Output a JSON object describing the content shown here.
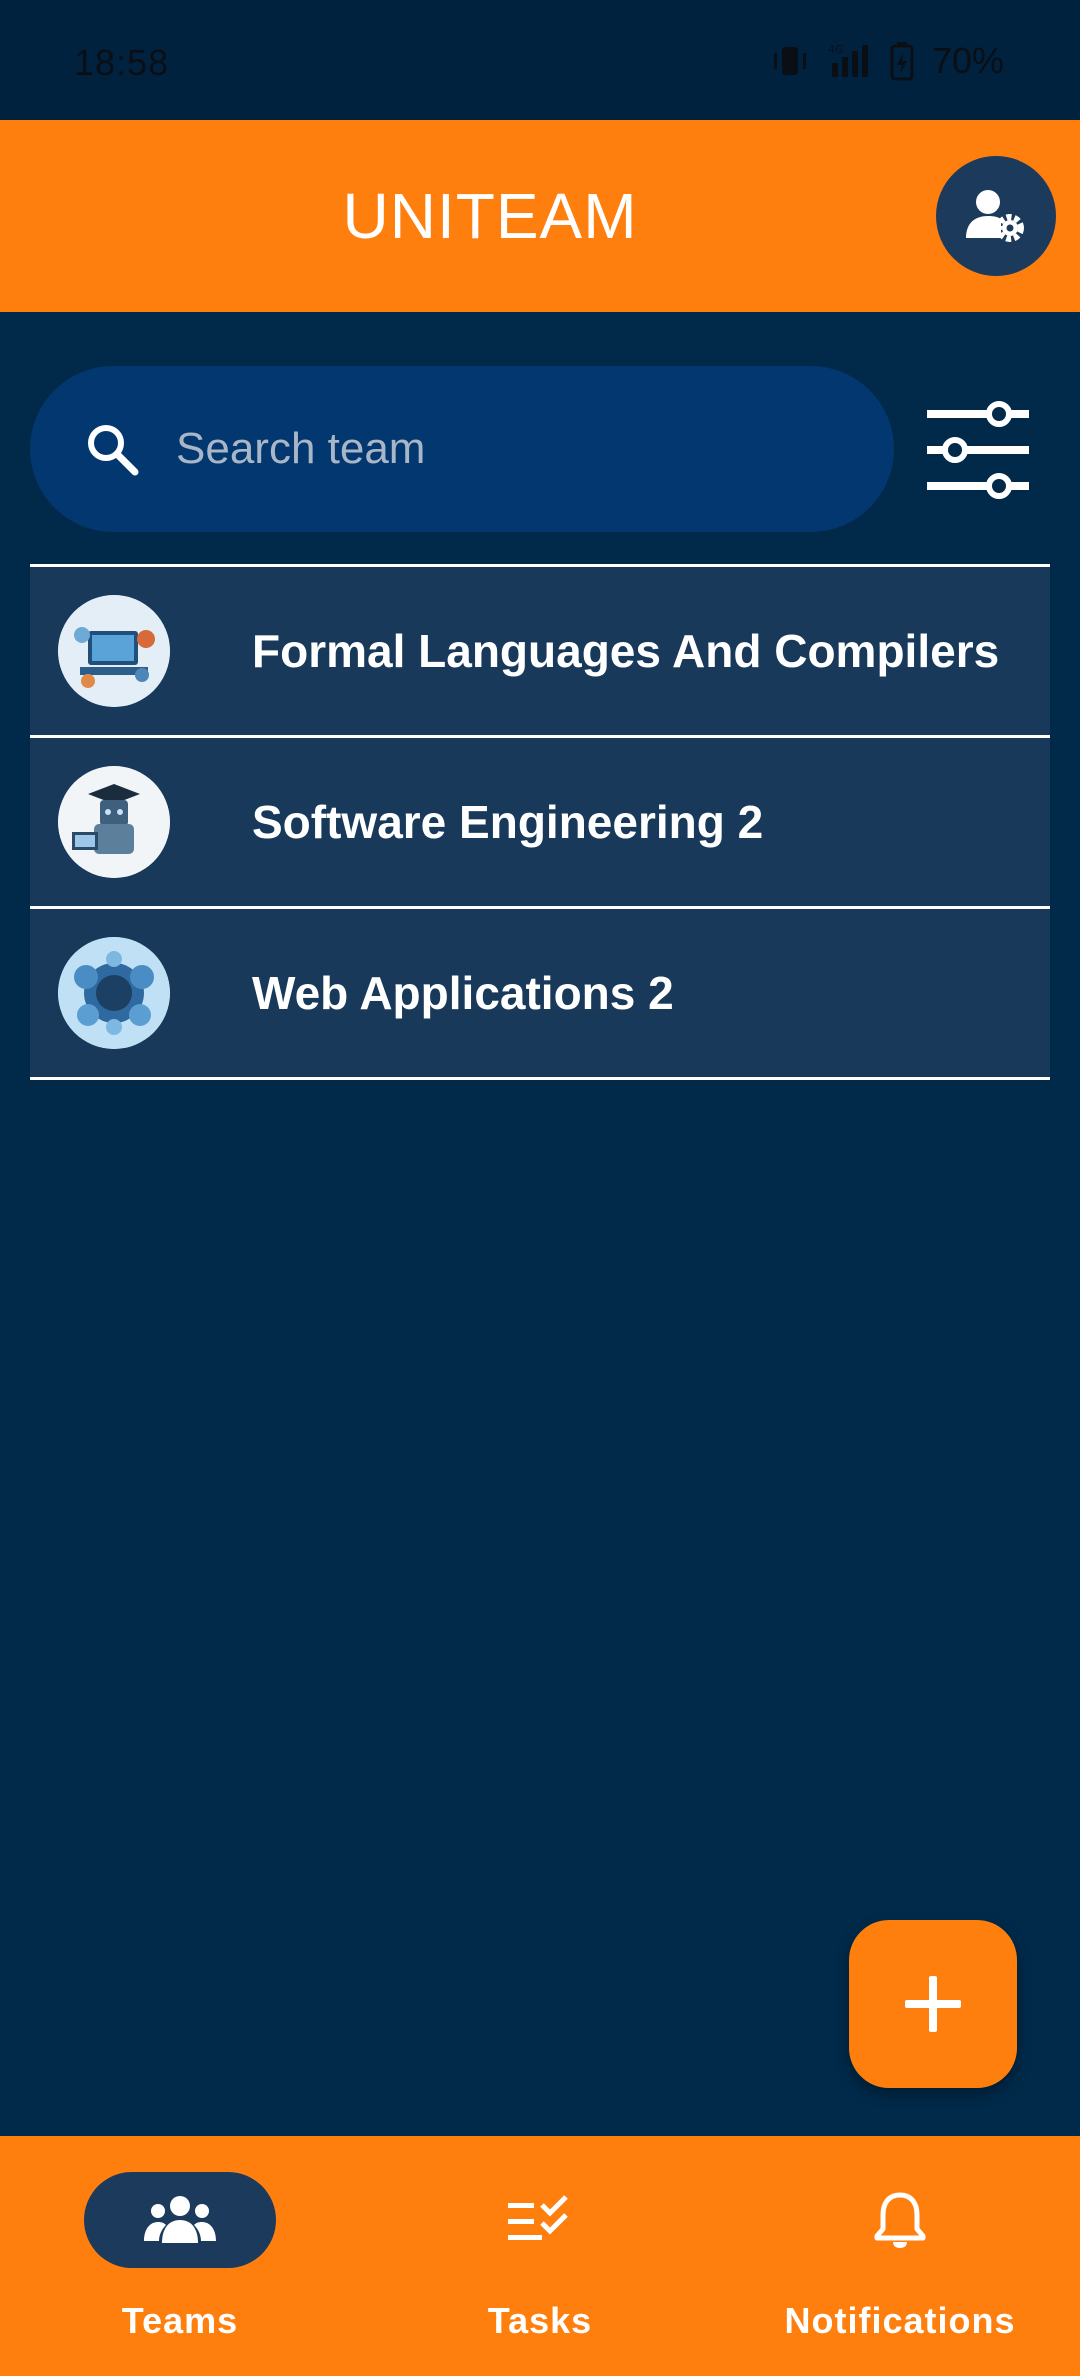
{
  "status_bar": {
    "time": "18:58",
    "battery": "70%",
    "icons": [
      "vibrate-icon",
      "signal-4g-icon",
      "battery-charging-icon"
    ]
  },
  "header": {
    "title": "UNITEAM",
    "profile_icon": "user-settings-icon"
  },
  "search": {
    "placeholder": "Search team",
    "value": "",
    "icon": "search-icon",
    "filter_icon": "sliders-icon"
  },
  "teams": [
    {
      "name": "Formal Languages And Compilers",
      "avatar_icon": "team-avatar-image"
    },
    {
      "name": "Software Engineering 2",
      "avatar_icon": "team-avatar-image"
    },
    {
      "name": "Web Applications 2",
      "avatar_icon": "team-avatar-image"
    }
  ],
  "fab": {
    "icon": "plus-icon"
  },
  "bottom_nav": {
    "items": [
      {
        "label": "Teams",
        "icon": "teams-icon",
        "active": true
      },
      {
        "label": "Tasks",
        "icon": "tasks-icon",
        "active": false
      },
      {
        "label": "Notifications",
        "icon": "bell-icon",
        "active": false
      }
    ]
  },
  "colors": {
    "background": "#012a4a",
    "accent": "#ff7f0e",
    "row": "#18395a",
    "search": "#02376f",
    "active_pill": "#1b3a5c"
  }
}
